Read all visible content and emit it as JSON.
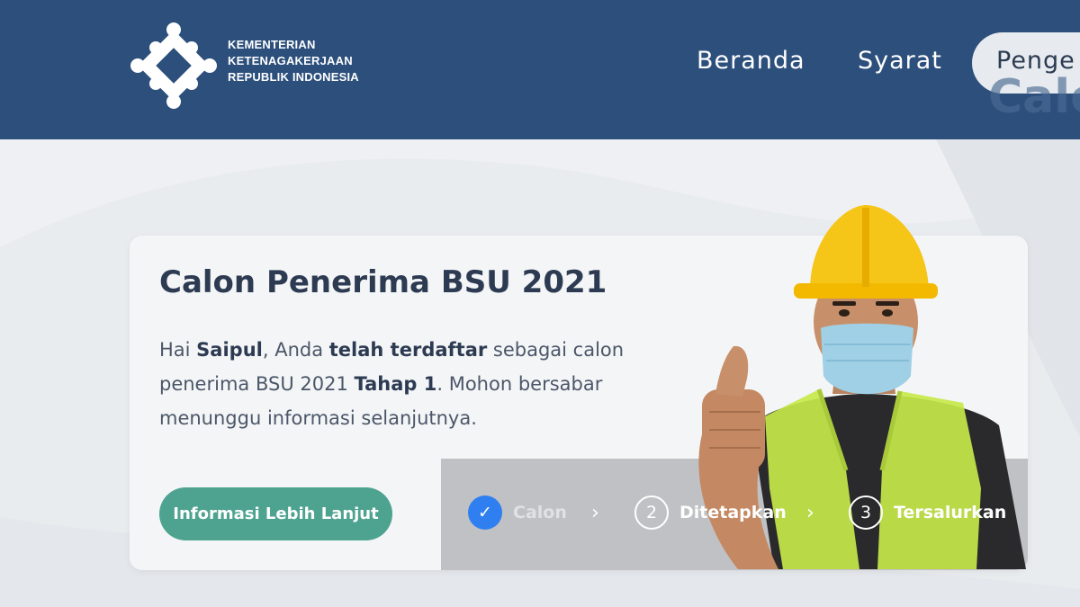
{
  "header": {
    "logo_lines": [
      "KEMENTERIAN",
      "KETENAGAKERJAAN",
      "REPUBLIK INDONESIA"
    ],
    "nav": {
      "home": "Beranda",
      "requirements": "Syarat",
      "active_partial": "Penge"
    },
    "ghost_text": "Calo"
  },
  "card": {
    "title": "Calon Penerima BSU 2021",
    "body": {
      "greeting": "Hai ",
      "name": "Saipul",
      "part1": ", Anda ",
      "status": "telah terdaftar",
      "part2": " sebagai calon penerima BSU 2021 ",
      "stage": "Tahap 1",
      "part3": ". Mohon bersabar menunggu informasi selanjutnya."
    },
    "button_label": "Informasi Lebih Lanjut"
  },
  "steps": [
    {
      "number": "✓",
      "label": "Calon",
      "state": "done"
    },
    {
      "number": "2",
      "label": "Ditetapkan",
      "state": "pending"
    },
    {
      "number": "3",
      "label": "Tersalurkan",
      "state": "pending"
    }
  ],
  "colors": {
    "header_bg": "#2c4f7c",
    "button_bg": "#4ea390",
    "step_active": "#2f7ff0",
    "helmet": "#f5c518",
    "vest": "#c5e84a"
  }
}
